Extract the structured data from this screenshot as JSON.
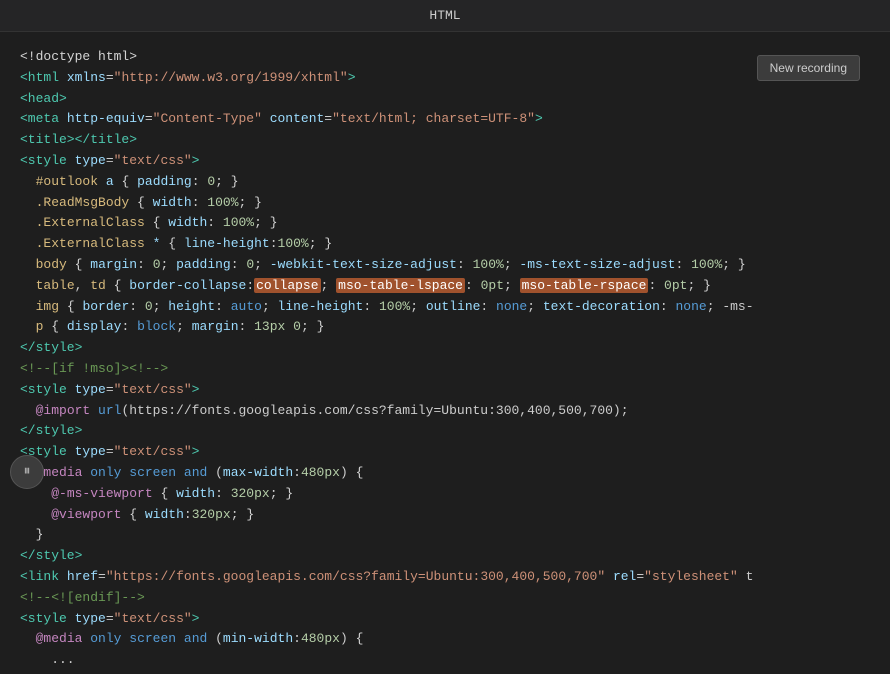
{
  "topbar": {
    "title": "HTML"
  },
  "new_recording_button": "New recording",
  "play_button": "▶▶",
  "code_lines": [
    "<!doctype html>",
    "<html xmlns=\"http://www.w3.org/1999/xhtml\">",
    "<head>",
    "<meta http-equiv=\"Content-Type\" content=\"text/html; charset=UTF-8\">",
    "<title></title>",
    "<style type=\"text/css\">",
    "  #outlook a { padding: 0; }",
    "  .ReadMsgBody { width: 100%; }",
    "  .ExternalClass { width: 100%; }",
    "  .ExternalClass * { line-height:100%; }",
    "  body { margin: 0; padding: 0; -webkit-text-size-adjust: 100%; -ms-text-size-adjust: 100%; }",
    "  table, td { border-collapse:collapse; mso-table-lspace: 0pt; mso-table-rspace: 0pt; }",
    "  img { border: 0; height: auto; line-height: 100%; outline: none; text-decoration: none; -ms-",
    "  p { display: block; margin: 13px 0; }",
    "</style>",
    "<!--[if !mso]><!-->",
    "<style type=\"text/css\">",
    "  @import url(https://fonts.googleapis.com/css?family=Ubuntu:300,400,500,700);",
    "</style>",
    "<style type=\"text/css\">",
    "  @media only screen and (max-width:480px) {",
    "    @-ms-viewport { width: 320px; }",
    "    @viewport { width: 320px; }",
    "  }",
    "</style>",
    "<link href=\"https://fonts.googleapis.com/css?family=Ubuntu:300,400,500,700\" rel=\"stylesheet\" t",
    "<!--<![endif]-->",
    "<style type=\"text/css\">",
    "  @media only screen and (min-width:480px) {",
    "    ..."
  ]
}
